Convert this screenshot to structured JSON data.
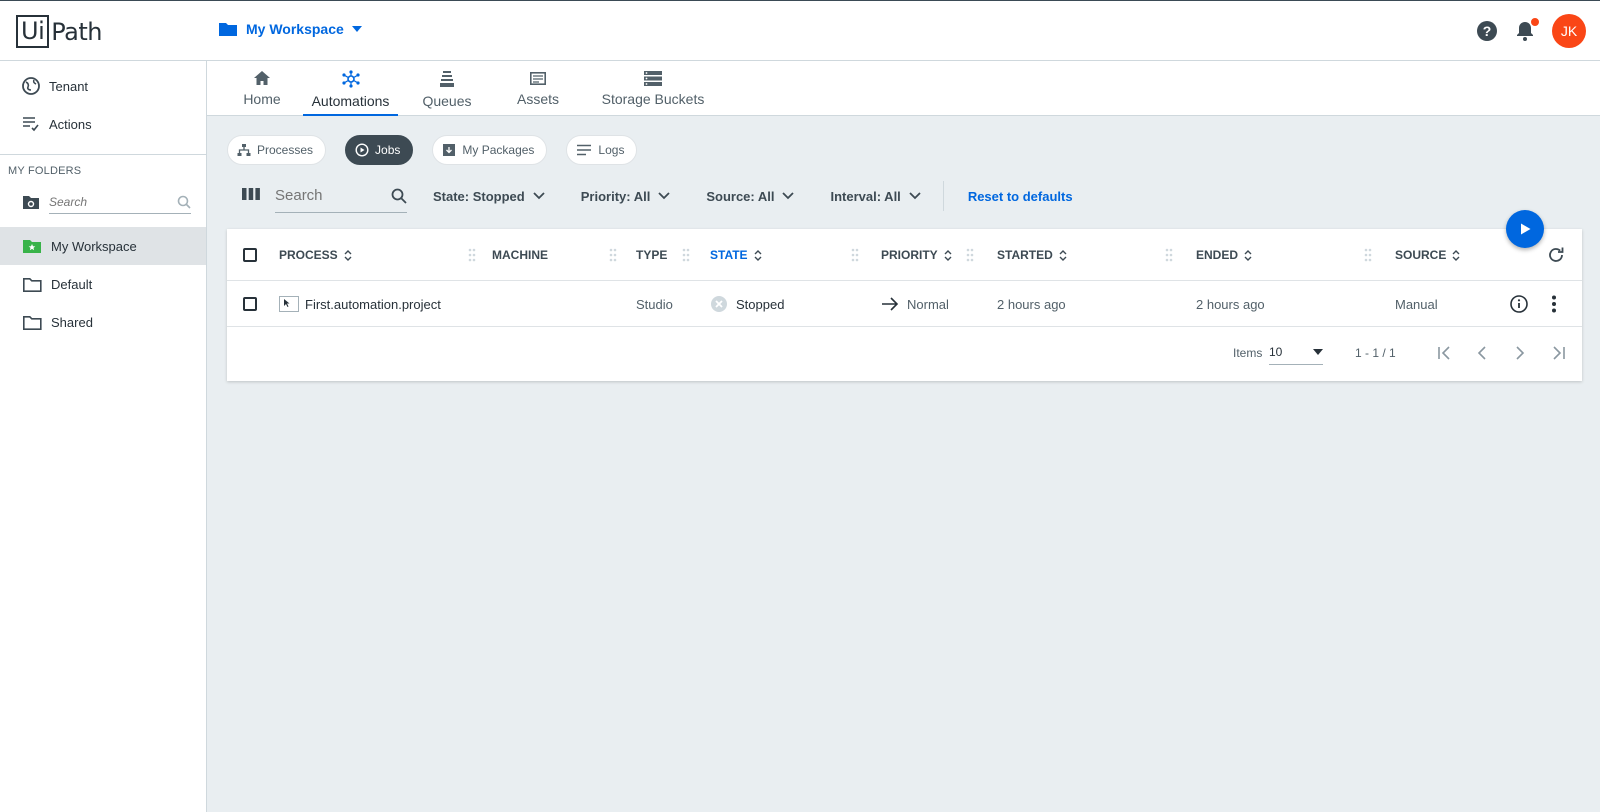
{
  "header": {
    "logo_text": "UiPath",
    "workspace_label": "My Workspace",
    "avatar_initials": "JK"
  },
  "sidebar": {
    "items_top": [
      {
        "label": "Tenant",
        "icon": "globe-icon"
      },
      {
        "label": "Actions",
        "icon": "actions-list-icon"
      }
    ],
    "folders_heading": "MY FOLDERS",
    "search_placeholder": "Search",
    "folders": [
      {
        "label": "My Workspace",
        "icon": "personal-folder-icon",
        "active": true
      },
      {
        "label": "Default",
        "icon": "folder-icon"
      },
      {
        "label": "Shared",
        "icon": "folder-icon"
      }
    ]
  },
  "tabs": [
    {
      "label": "Home",
      "icon": "home-icon"
    },
    {
      "label": "Automations",
      "icon": "automations-icon",
      "active": true
    },
    {
      "label": "Queues",
      "icon": "queues-icon"
    },
    {
      "label": "Assets",
      "icon": "assets-icon"
    },
    {
      "label": "Storage Buckets",
      "icon": "storage-buckets-icon"
    }
  ],
  "chips": [
    {
      "label": "Processes",
      "icon": "processes-icon"
    },
    {
      "label": "Jobs",
      "icon": "jobs-icon",
      "active": true
    },
    {
      "label": "My Packages",
      "icon": "packages-icon"
    },
    {
      "label": "Logs",
      "icon": "logs-icon"
    }
  ],
  "filters": {
    "search_placeholder": "Search",
    "state": "State: Stopped",
    "priority": "Priority: All",
    "source": "Source: All",
    "interval": "Interval: All",
    "reset": "Reset to defaults"
  },
  "table": {
    "columns": [
      "PROCESS",
      "MACHINE",
      "TYPE",
      "STATE",
      "PRIORITY",
      "STARTED",
      "ENDED",
      "SOURCE"
    ],
    "sorted_column": "STATE",
    "rows": [
      {
        "process": "First.automation.project",
        "machine": "",
        "type": "Studio",
        "state": "Stopped",
        "priority": "Normal",
        "started": "2 hours ago",
        "ended": "2 hours ago",
        "source": "Manual"
      }
    ],
    "footer": {
      "items_label": "Items",
      "page_size": "10",
      "range": "1 - 1 / 1"
    }
  },
  "colors": {
    "accent": "#0067df",
    "avatar": "#fa4616",
    "active_chip": "#3d4a53",
    "background": "#e9eef1"
  }
}
